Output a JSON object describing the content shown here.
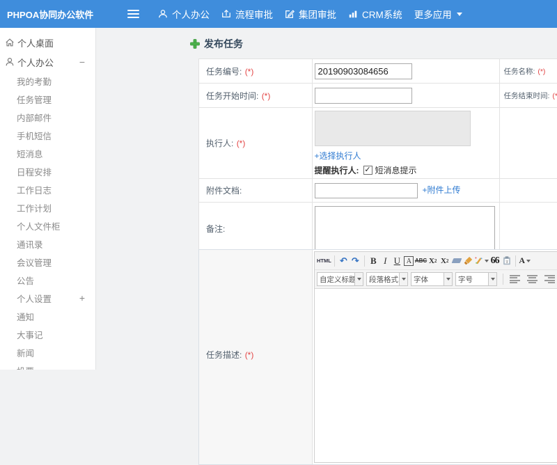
{
  "topbar": {
    "logo": "PHPOA协同办公软件",
    "items": [
      {
        "label": "个人办公"
      },
      {
        "label": "流程审批"
      },
      {
        "label": "集团审批"
      },
      {
        "label": "CRM系统"
      },
      {
        "label": "更多应用"
      }
    ]
  },
  "sidebar": {
    "collapse_symbol": "−",
    "expand_symbol": "+",
    "items": [
      {
        "label": "个人桌面"
      },
      {
        "label": "个人办公"
      },
      {
        "label": "我的考勤"
      },
      {
        "label": "任务管理"
      },
      {
        "label": "内部邮件"
      },
      {
        "label": "手机短信"
      },
      {
        "label": "短消息"
      },
      {
        "label": "日程安排"
      },
      {
        "label": "工作日志"
      },
      {
        "label": "工作计划"
      },
      {
        "label": "个人文件柜"
      },
      {
        "label": "通讯录"
      },
      {
        "label": "会议管理"
      },
      {
        "label": "公告"
      },
      {
        "label": "个人设置"
      },
      {
        "label": "通知"
      },
      {
        "label": "大事记"
      },
      {
        "label": "新闻"
      },
      {
        "label": "投票"
      }
    ]
  },
  "main": {
    "title": "发布任务",
    "required_mark": "(*)",
    "form": {
      "task_no_label": "任务编号:",
      "task_no_value": "20190903084656",
      "task_name_label": "任务名称:",
      "start_time_label": "任务开始时间:",
      "end_time_label": "任务结束时间:",
      "executor_label": "执行人:",
      "choose_executor_link": "+选择执行人",
      "remind_label": "提醒执行人:",
      "sms_checkbox_label": "短消息提示",
      "attachment_label": "附件文档:",
      "attachment_link": "+附件上传",
      "note_label": "备注:",
      "desc_label": "任务描述:"
    },
    "editor": {
      "html_btn": "HTML",
      "bold": "B",
      "italic": "I",
      "underline": "U",
      "font_box": "A",
      "strike": "ABC",
      "sup_base": "X",
      "sup": "2",
      "sub_base": "X",
      "sub": "2",
      "quote": "66",
      "color_btn": "A",
      "dropdowns": [
        "自定义标题",
        "段落格式",
        "字体",
        "字号"
      ]
    }
  }
}
